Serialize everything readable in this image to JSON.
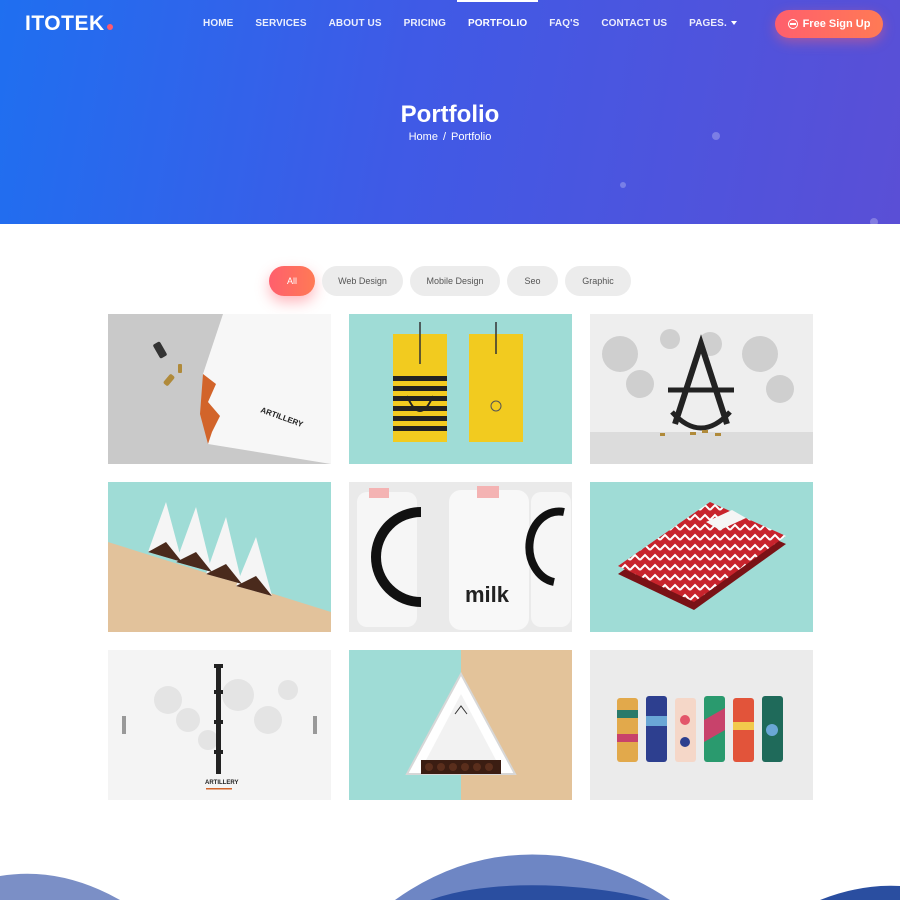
{
  "brand": {
    "name": "ITOTEK",
    "accent": "#ff5a6e"
  },
  "nav": {
    "items": [
      {
        "label": "HOME"
      },
      {
        "label": "SERVICES"
      },
      {
        "label": "ABOUT US"
      },
      {
        "label": "PRICING"
      },
      {
        "label": "PORTFOLIO",
        "active": true
      },
      {
        "label": "FAQ'S"
      },
      {
        "label": "CONTACT US"
      },
      {
        "label": "PAGES."
      }
    ],
    "signup_label": "Free Sign Up"
  },
  "hero": {
    "title": "Portfolio",
    "breadcrumb": {
      "home": "Home",
      "separator": "/",
      "current": "Portfolio"
    },
    "gradient": [
      "#1f6ff0",
      "#5a4fd6"
    ]
  },
  "filters": {
    "items": [
      {
        "label": "All",
        "active": true
      },
      {
        "label": "Web Design"
      },
      {
        "label": "Mobile Design"
      },
      {
        "label": "Seo"
      },
      {
        "label": "Graphic"
      }
    ]
  },
  "portfolio": {
    "tiles": [
      {
        "subject": "artillery-letterhead",
        "text": "ARTILLERY"
      },
      {
        "subject": "yellow-striped-packaging"
      },
      {
        "subject": "monogram-sculpture"
      },
      {
        "subject": "folded-card-display"
      },
      {
        "subject": "milk-bottles",
        "text": "milk"
      },
      {
        "subject": "red-chevron-box"
      },
      {
        "subject": "isaurvo-poster",
        "text": "ARTILLERY"
      },
      {
        "subject": "triangle-chocolate-box"
      },
      {
        "subject": "patterned-tubes"
      }
    ]
  }
}
